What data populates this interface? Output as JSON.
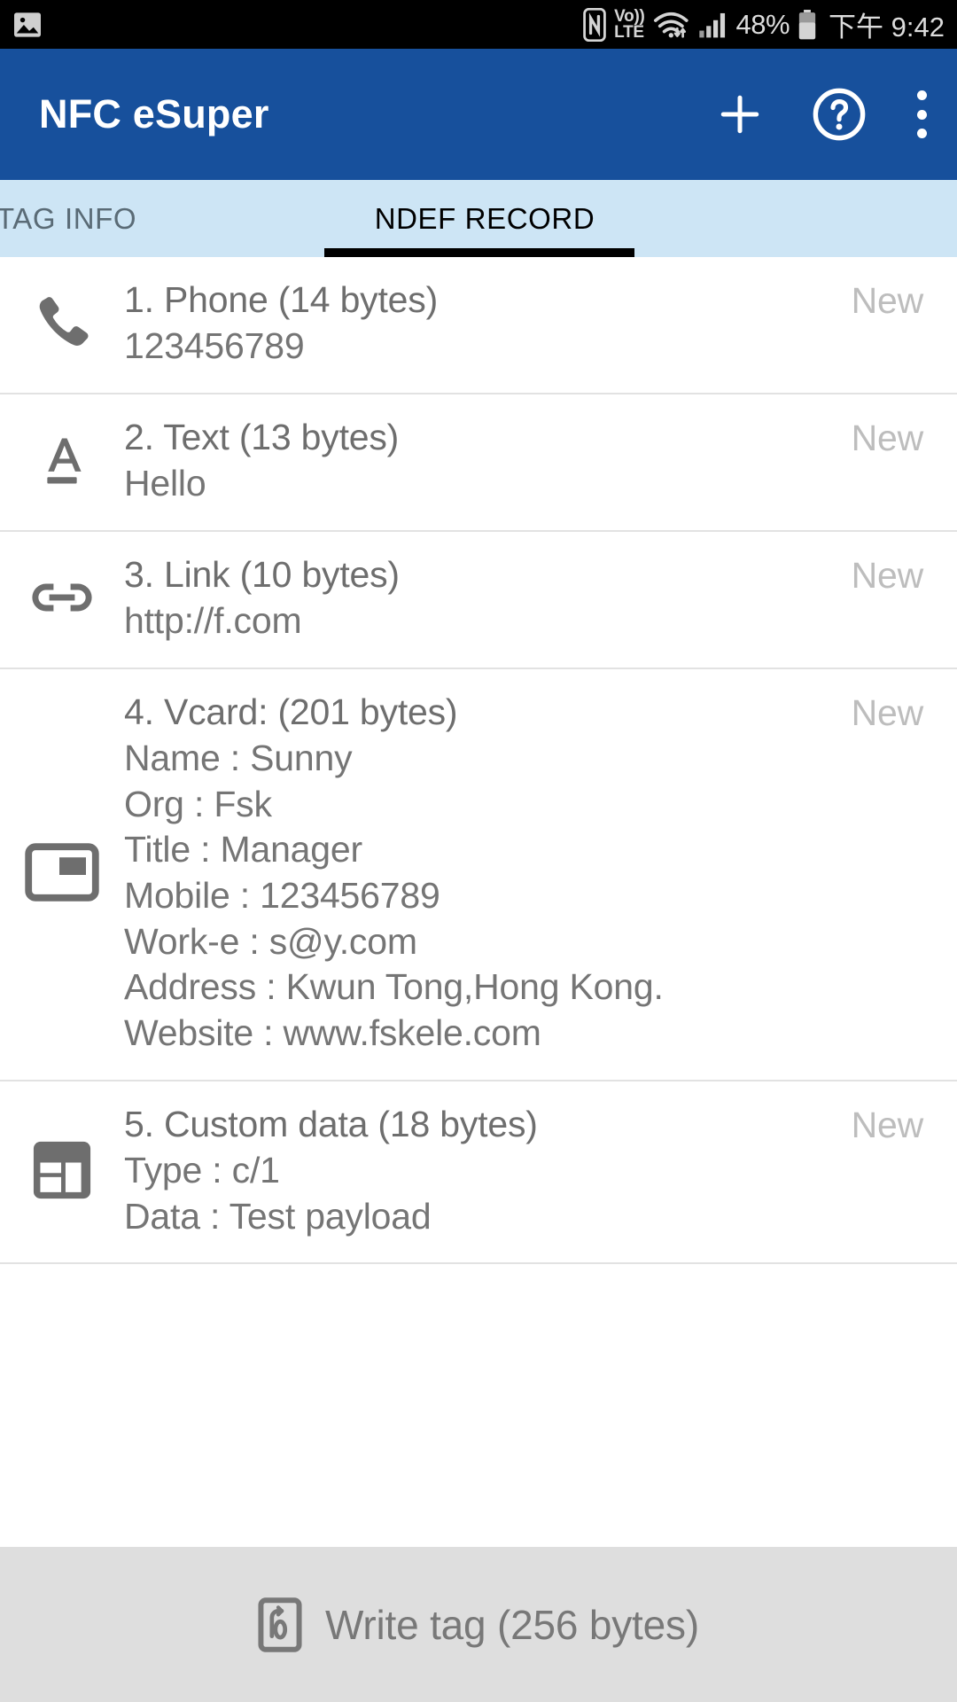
{
  "status_bar": {
    "left_icons": [
      {
        "name": "photo-icon",
        "label": "photo"
      }
    ],
    "right_icons": [
      {
        "name": "nfc-icon",
        "label": "NFC"
      },
      {
        "name": "volte-icon",
        "line1": "Vo))",
        "line2": "LTE"
      },
      {
        "name": "wifi-icon",
        "label": "wifi"
      },
      {
        "name": "signal-icon",
        "label": "signal"
      }
    ],
    "battery_percent": "48%",
    "battery_icon": "battery-icon",
    "time": "下午 9:42"
  },
  "app_bar": {
    "title": "NFC eSuper",
    "actions": [
      {
        "name": "add-button",
        "icon": "plus-icon"
      },
      {
        "name": "help-button",
        "icon": "help-circle-icon"
      },
      {
        "name": "overflow-menu-button",
        "icon": "overflow-menu-icon"
      }
    ],
    "background_color": "#17509c"
  },
  "tabs": {
    "items": [
      {
        "label": "TAG INFO",
        "active": false
      },
      {
        "label": "NDEF RECORD",
        "active": true
      }
    ],
    "background_color": "#cde5f5",
    "indicator_color": "#000000"
  },
  "records": [
    {
      "icon": "phone-icon",
      "title": "1. Phone (14 bytes)",
      "lines": [
        "123456789"
      ],
      "status": "New"
    },
    {
      "icon": "text-format-icon",
      "title": "2. Text (13 bytes)",
      "lines": [
        "Hello"
      ],
      "status": "New"
    },
    {
      "icon": "link-icon",
      "title": "3. Link (10 bytes)",
      "lines": [
        "http://f.com"
      ],
      "status": "New"
    },
    {
      "icon": "vcard-icon",
      "title": "4. Vcard: (201 bytes)",
      "lines": [
        "Name : Sunny",
        "Org : Fsk",
        "Title : Manager",
        "Mobile : 123456789",
        "Work-e : s@y.com",
        "Address : Kwun Tong,Hong Kong.",
        "Website : www.fskele.com"
      ],
      "status": "New"
    },
    {
      "icon": "custom-data-icon",
      "title": "5. Custom data (18 bytes)",
      "lines": [
        "Type : c/1",
        "Data : Test payload"
      ],
      "status": "New"
    }
  ],
  "bottom_bar": {
    "icon": "nfc-write-icon",
    "label": "Write tag   (256 bytes)",
    "background_color": "#dedede"
  },
  "colors": {
    "primary": "#17509c",
    "tab_bg": "#cde5f5",
    "text": "#757575",
    "muted": "#bdbdbd",
    "bottom_bg": "#dedede"
  }
}
